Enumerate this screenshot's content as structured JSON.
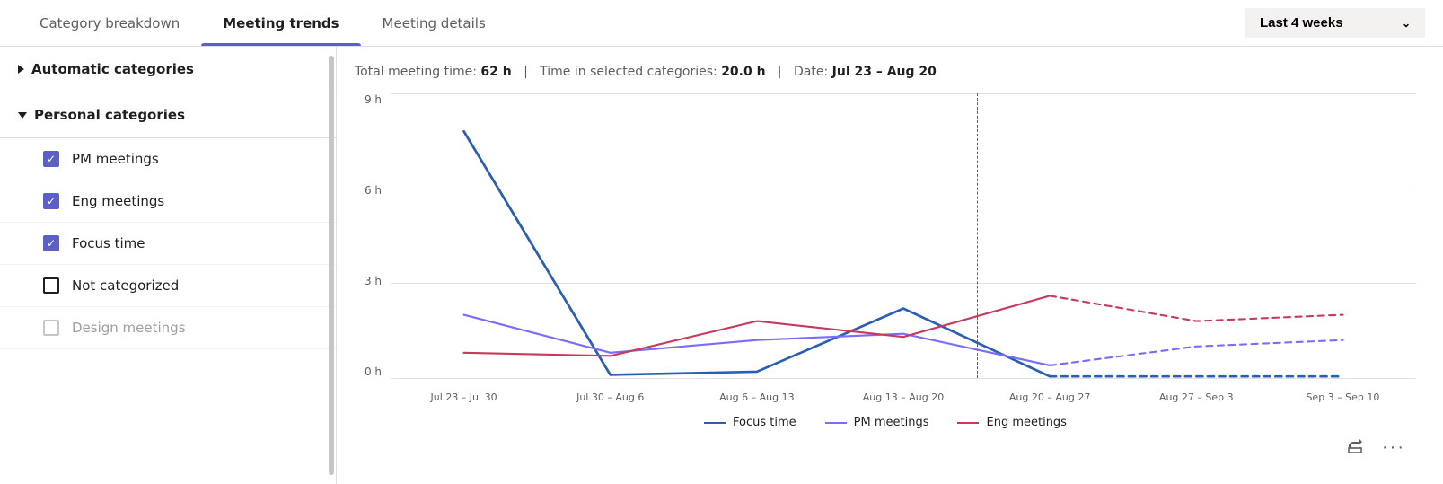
{
  "tabs": [
    {
      "id": "category-breakdown",
      "label": "Category breakdown",
      "active": false
    },
    {
      "id": "meeting-trends",
      "label": "Meeting trends",
      "active": true
    },
    {
      "id": "meeting-details",
      "label": "Meeting details",
      "active": false
    }
  ],
  "period_selector": {
    "label": "Last 4 weeks",
    "chevron": "chevron-down"
  },
  "summary": {
    "total_meeting_time_label": "Total meeting time:",
    "total_meeting_time_value": "62 h",
    "time_in_selected_label": "Time in selected categories:",
    "time_in_selected_value": "20.0 h",
    "date_label": "Date:",
    "date_value": "Jul 23 – Aug 20"
  },
  "sidebar": {
    "automatic_section": {
      "label": "Automatic categories",
      "expanded": false
    },
    "personal_section": {
      "label": "Personal categories",
      "expanded": true,
      "items": [
        {
          "id": "pm-meetings",
          "label": "PM meetings",
          "checked": true,
          "disabled": false
        },
        {
          "id": "eng-meetings",
          "label": "Eng meetings",
          "checked": true,
          "disabled": false
        },
        {
          "id": "focus-time",
          "label": "Focus time",
          "checked": true,
          "disabled": false
        },
        {
          "id": "not-categorized",
          "label": "Not categorized",
          "checked": false,
          "disabled": false
        },
        {
          "id": "design-meetings",
          "label": "Design meetings",
          "checked": false,
          "disabled": true
        }
      ]
    }
  },
  "chart": {
    "y_labels": [
      "9 h",
      "6 h",
      "3 h",
      "0 h"
    ],
    "x_labels": [
      "Jul 23 – Jul 30",
      "Jul 30 – Aug 6",
      "Aug 6 – Aug 13",
      "Aug 13 – Aug 20",
      "Aug 20 – Aug 27",
      "Aug 27 – Sep 3",
      "Sep 3 – Sep 10"
    ],
    "dashed_vertical_position_pct": 57.1,
    "series": {
      "focus_time": {
        "label": "Focus time",
        "color": "#2c5fb3",
        "points": [
          {
            "x_idx": 0,
            "value": 7.8
          },
          {
            "x_idx": 1,
            "value": 0.1
          },
          {
            "x_idx": 2,
            "value": 0.2
          },
          {
            "x_idx": 3,
            "value": 2.2
          },
          {
            "x_idx": 4,
            "value": 0.05
          }
        ],
        "dotted_points": [
          {
            "x_idx": 4,
            "value": 0.05
          },
          {
            "x_idx": 5,
            "value": 0.05
          },
          {
            "x_idx": 6,
            "value": 0.05
          }
        ]
      },
      "pm_meetings": {
        "label": "PM meetings",
        "color": "#7a6cff",
        "points": [
          {
            "x_idx": 0,
            "value": 2.0
          },
          {
            "x_idx": 1,
            "value": 0.8
          },
          {
            "x_idx": 2,
            "value": 1.2
          },
          {
            "x_idx": 3,
            "value": 1.4
          },
          {
            "x_idx": 4,
            "value": 0.4
          }
        ],
        "dotted_points": [
          {
            "x_idx": 4,
            "value": 0.4
          },
          {
            "x_idx": 5,
            "value": 1.0
          },
          {
            "x_idx": 6,
            "value": 1.2
          }
        ]
      },
      "eng_meetings": {
        "label": "Eng meetings",
        "color": "#c9395c",
        "points": [
          {
            "x_idx": 0,
            "value": 0.8
          },
          {
            "x_idx": 1,
            "value": 0.7
          },
          {
            "x_idx": 2,
            "value": 1.8
          },
          {
            "x_idx": 3,
            "value": 1.3
          },
          {
            "x_idx": 4,
            "value": 2.6
          }
        ],
        "dotted_points": [
          {
            "x_idx": 4,
            "value": 2.6
          },
          {
            "x_idx": 5,
            "value": 1.8
          },
          {
            "x_idx": 6,
            "value": 2.0
          }
        ]
      }
    }
  },
  "legend": [
    {
      "id": "focus-time",
      "label": "Focus time",
      "color": "#2c5fb3"
    },
    {
      "id": "pm-meetings",
      "label": "PM meetings",
      "color": "#7a6cff"
    },
    {
      "id": "eng-meetings",
      "label": "Eng meetings",
      "color": "#c9395c"
    }
  ],
  "actions": {
    "share_label": "share",
    "more_label": "more"
  }
}
